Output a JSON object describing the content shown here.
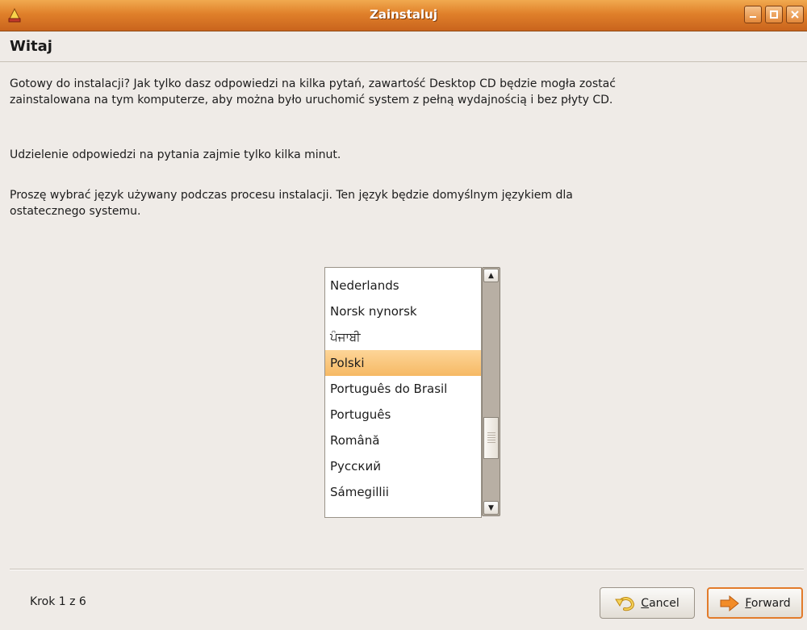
{
  "window": {
    "title": "Zainstaluj",
    "app_icon": "installer-icon",
    "controls": [
      "minimize-icon",
      "maximize-icon",
      "close-icon"
    ]
  },
  "header": {
    "title": "Witaj"
  },
  "main": {
    "intro": "Gotowy do instalacji? Jak tylko dasz odpowiedzi na kilka pytań, zawartość Desktop CD będzie mogła zostać zainstalowana na tym komputerze, aby można było uruchomić system z pełną wydajnością i bez płyty CD.",
    "minutes_note": "Udzielenie odpowiedzi na pytania zajmie tylko kilka minut.",
    "language_prompt": "Proszę wybrać język używany podczas procesu instalacji. Ten język będzie domyślnym językiem dla ostatecznego systemu."
  },
  "language_list": {
    "items": [
      "Nederlands",
      "Norsk nynorsk",
      "ਪੰਜਾਬੀ",
      "Polski",
      "Português do Brasil",
      "Português",
      "Română",
      "Русский",
      "Sámegillii"
    ],
    "selected": "Polski"
  },
  "footer": {
    "step": "Krok 1 z 6",
    "cancel_label": "Cancel",
    "forward_label": "Forward"
  },
  "colors": {
    "titlebar": "#e0802a",
    "selection": "#f6b964",
    "background": "#efebe7",
    "forward_border": "#e27b2b"
  }
}
